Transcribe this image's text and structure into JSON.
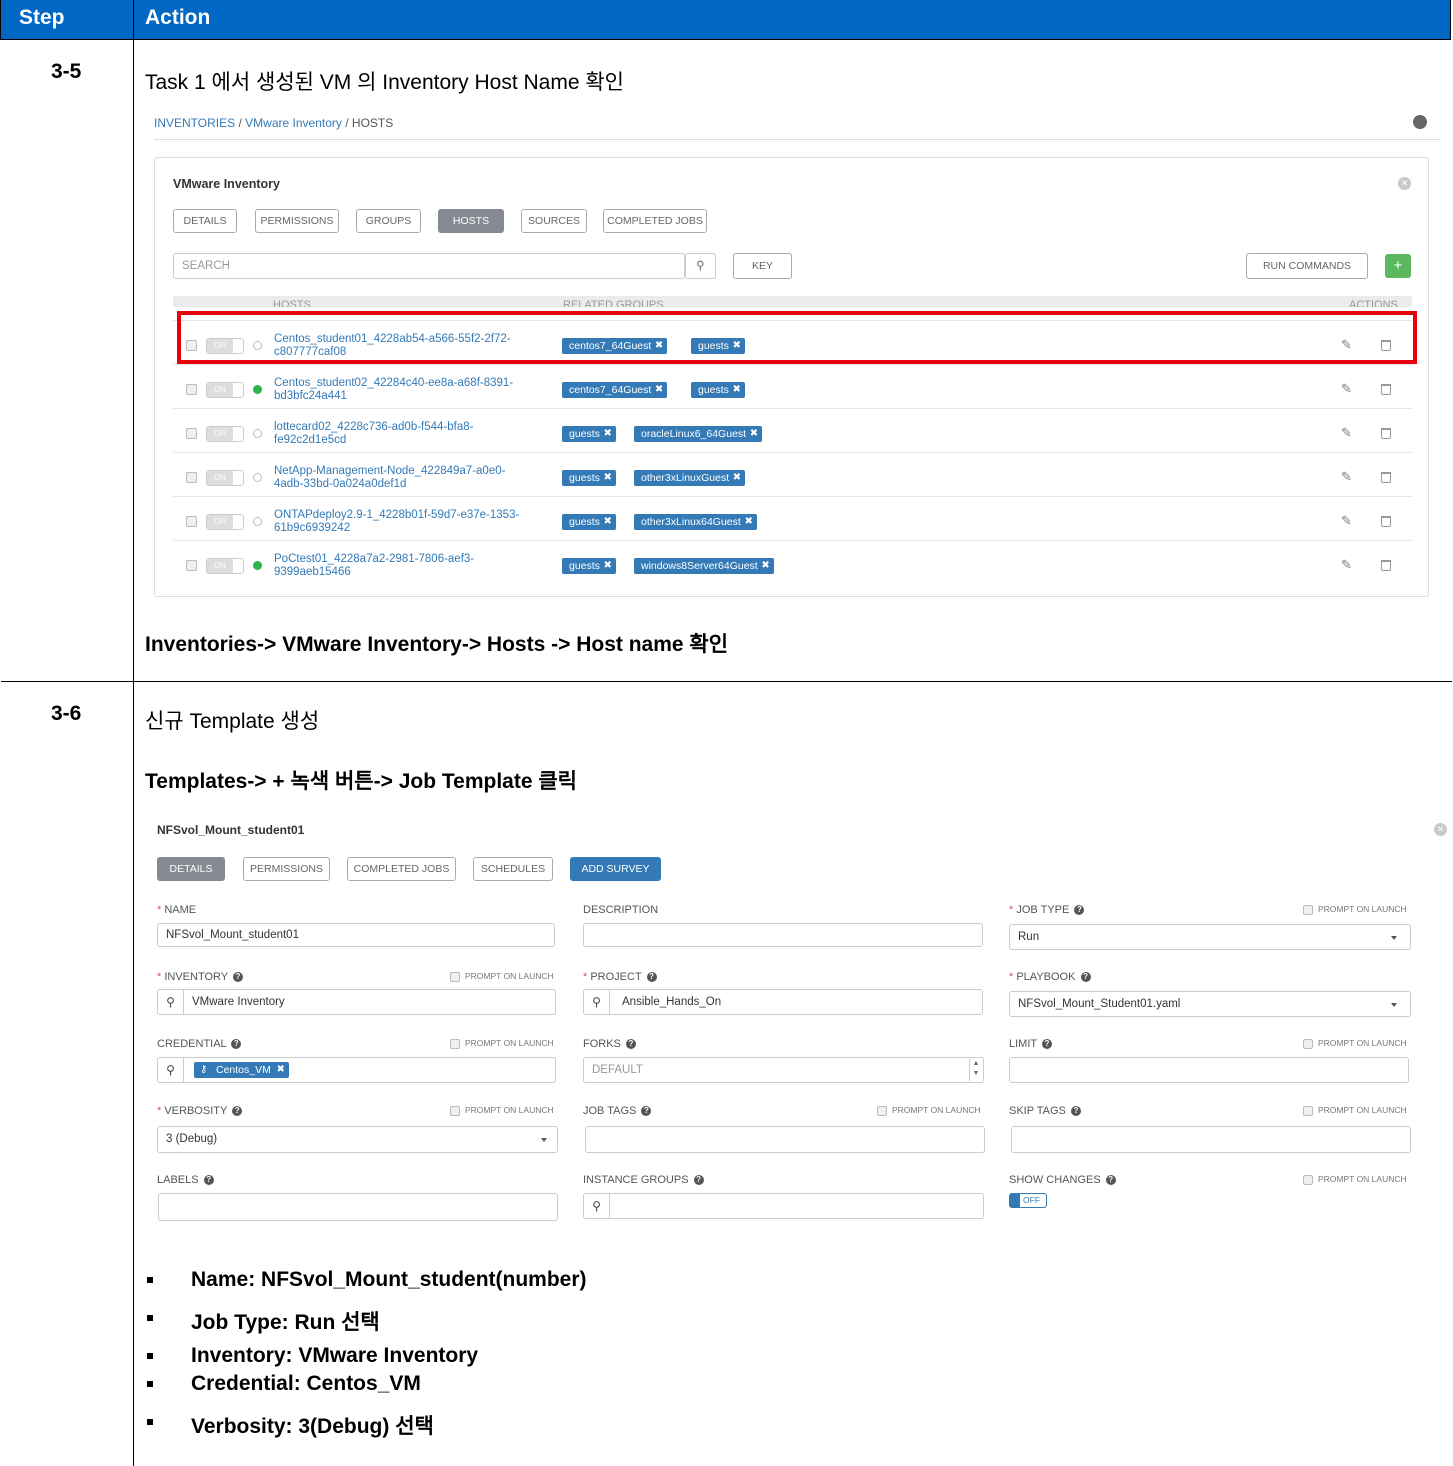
{
  "header": {
    "step": "Step",
    "action": "Action"
  },
  "step35": {
    "num": "3-5",
    "title": "Task 1 에서 생성된 VM 의 Inventory Host Name 확인",
    "breadcrumb": {
      "a": "INVENTORIES",
      "sep": "/",
      "b": "VMware Inventory",
      "c": "HOSTS"
    },
    "panel_title": "VMware Inventory",
    "tabs": [
      "DETAILS",
      "PERMISSIONS",
      "GROUPS",
      "HOSTS",
      "SOURCES",
      "COMPLETED JOBS"
    ],
    "search_placeholder": "SEARCH",
    "key_label": "KEY",
    "run_commands": "RUN COMMANDS",
    "add_label": "+",
    "col_hosts": "HOSTS",
    "col_groups": "RELATED GROUPS",
    "col_actions": "ACTIONS",
    "toggle_on": "ON",
    "hosts": [
      {
        "name1": "Centos_student01_4228ab54-a566-55f2-2f72-",
        "name2": "c807777caf08",
        "tags": [
          "centos7_64Guest",
          "guests"
        ],
        "active": false
      },
      {
        "name1": "Centos_student02_42284c40-ee8a-a68f-8391-",
        "name2": "bd3bfc24a441",
        "tags": [
          "centos7_64Guest",
          "guests"
        ],
        "active": true
      },
      {
        "name1": "lottecard02_4228c736-ad0b-f544-bfa8-",
        "name2": "fe92c2d1e5cd",
        "tags": [
          "guests",
          "oracleLinux6_64Guest"
        ],
        "active": false
      },
      {
        "name1": "NetApp-Management-Node_422849a7-a0e0-",
        "name2": "4adb-33bd-0a024a0def1d",
        "tags": [
          "guests",
          "other3xLinuxGuest"
        ],
        "active": false
      },
      {
        "name1": "ONTAPdeploy2.9-1_4228b01f-59d7-e37e-1353-",
        "name2": "61b9c6939242",
        "tags": [
          "guests",
          "other3xLinux64Guest"
        ],
        "active": false
      },
      {
        "name1": "PoCtest01_4228a7a2-2981-7806-aef3-",
        "name2": "9399aeb15466",
        "tags": [
          "guests",
          "windows8Server64Guest"
        ],
        "active": true
      }
    ],
    "caption": "Inventories-> VMware Inventory-> Hosts -> Host name 확인"
  },
  "step36": {
    "num": "3-6",
    "title": "신규 Template 생성",
    "subtitle": "Templates-> + 녹색 버튼-> Job Template 클릭",
    "form_title": "NFSvol_Mount_student01",
    "tabs": [
      "DETAILS",
      "PERMISSIONS",
      "COMPLETED JOBS",
      "SCHEDULES",
      "ADD SURVEY"
    ],
    "prompt": "PROMPT ON LAUNCH",
    "fields": {
      "name_label": "NAME",
      "name_value": "NFSvol_Mount_student01",
      "description_label": "DESCRIPTION",
      "job_type_label": "JOB TYPE",
      "job_type_value": "Run",
      "inventory_label": "INVENTORY",
      "inventory_value": "VMware Inventory",
      "project_label": "PROJECT",
      "project_value": "Ansible_Hands_On",
      "playbook_label": "PLAYBOOK",
      "playbook_value": "NFSvol_Mount_Student01.yaml",
      "credential_label": "CREDENTIAL",
      "credential_value": "Centos_VM",
      "forks_label": "FORKS",
      "forks_placeholder": "DEFAULT",
      "limit_label": "LIMIT",
      "verbosity_label": "VERBOSITY",
      "verbosity_value": "3 (Debug)",
      "job_tags_label": "JOB TAGS",
      "skip_tags_label": "SKIP TAGS",
      "labels_label": "LABELS",
      "instance_groups_label": "INSTANCE GROUPS",
      "show_changes_label": "SHOW CHANGES",
      "show_changes_value": "OFF"
    },
    "bullets": [
      "Name: NFSvol_Mount_student(number)",
      "Job Type: Run 선택",
      "Inventory:  VMware Inventory",
      "Credential: Centos_VM",
      "Verbosity: 3(Debug) 선택"
    ]
  },
  "colors": {
    "header_blue": "#0067c5",
    "highlight_red": "#e8000b",
    "tag_blue": "#337ab7",
    "add_green": "#5cb85c"
  }
}
